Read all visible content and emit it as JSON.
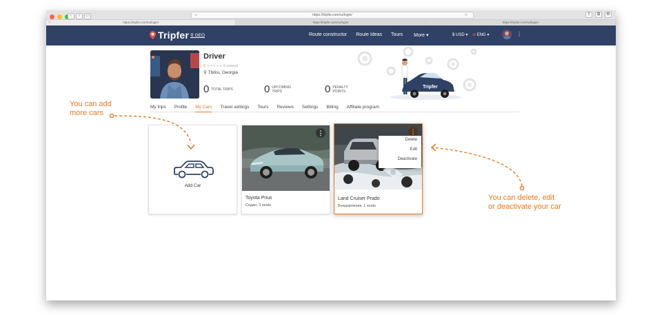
{
  "browser": {
    "url": "https://tripfer.com/ru/login/",
    "tabs": [
      "https://tripfer.com/ru/login/",
      "https://tripfer.com/ru/login/",
      "https://tripfer.com/ru/login/"
    ],
    "traffic_colors": [
      "#ff5f57",
      "#ffbd2e",
      "#28c840"
    ]
  },
  "navbar": {
    "brand": "Tripfer",
    "geo": "GEO",
    "menu": [
      "Route constructor",
      "Route Ideas",
      "Tours"
    ],
    "more": "More ▾",
    "currency": "$ USD ▾",
    "language": "ENG ▾",
    "kebab": "⋮",
    "color": "#2f4165"
  },
  "profile": {
    "name": "Driver",
    "rating_value": "0",
    "stars": "★★★★★",
    "reviews": "0 reviews",
    "location": "Tbilisi, Georgia",
    "stats": [
      {
        "value": "0",
        "label": "TOTAL TRIPS"
      },
      {
        "value": "0",
        "label": "UPCOMING TRIPS"
      },
      {
        "value": "0",
        "label": "PENALTY POINTS"
      }
    ]
  },
  "subnav": {
    "items": [
      "My trips",
      "Profile",
      "My Cars",
      "Travel settings",
      "Tours",
      "Reviews",
      "Settings",
      "Billing",
      "Affiliate program"
    ],
    "active": "My Cars"
  },
  "cards": {
    "add": {
      "label": "Add Car"
    },
    "prius": {
      "title": "Toyota Prius",
      "sub": "Седан, 3 seats"
    },
    "prado": {
      "title": "Land Cruiser Prado",
      "sub": "Внедорожник, 1 seats"
    }
  },
  "dropdown": [
    "Delete",
    "Edit",
    "Deactivate"
  ],
  "annotations": {
    "left": [
      "You can add",
      "more cars"
    ],
    "right": [
      "You can delete, edit",
      "or deactivate your car"
    ]
  },
  "accent": "#e8791e"
}
